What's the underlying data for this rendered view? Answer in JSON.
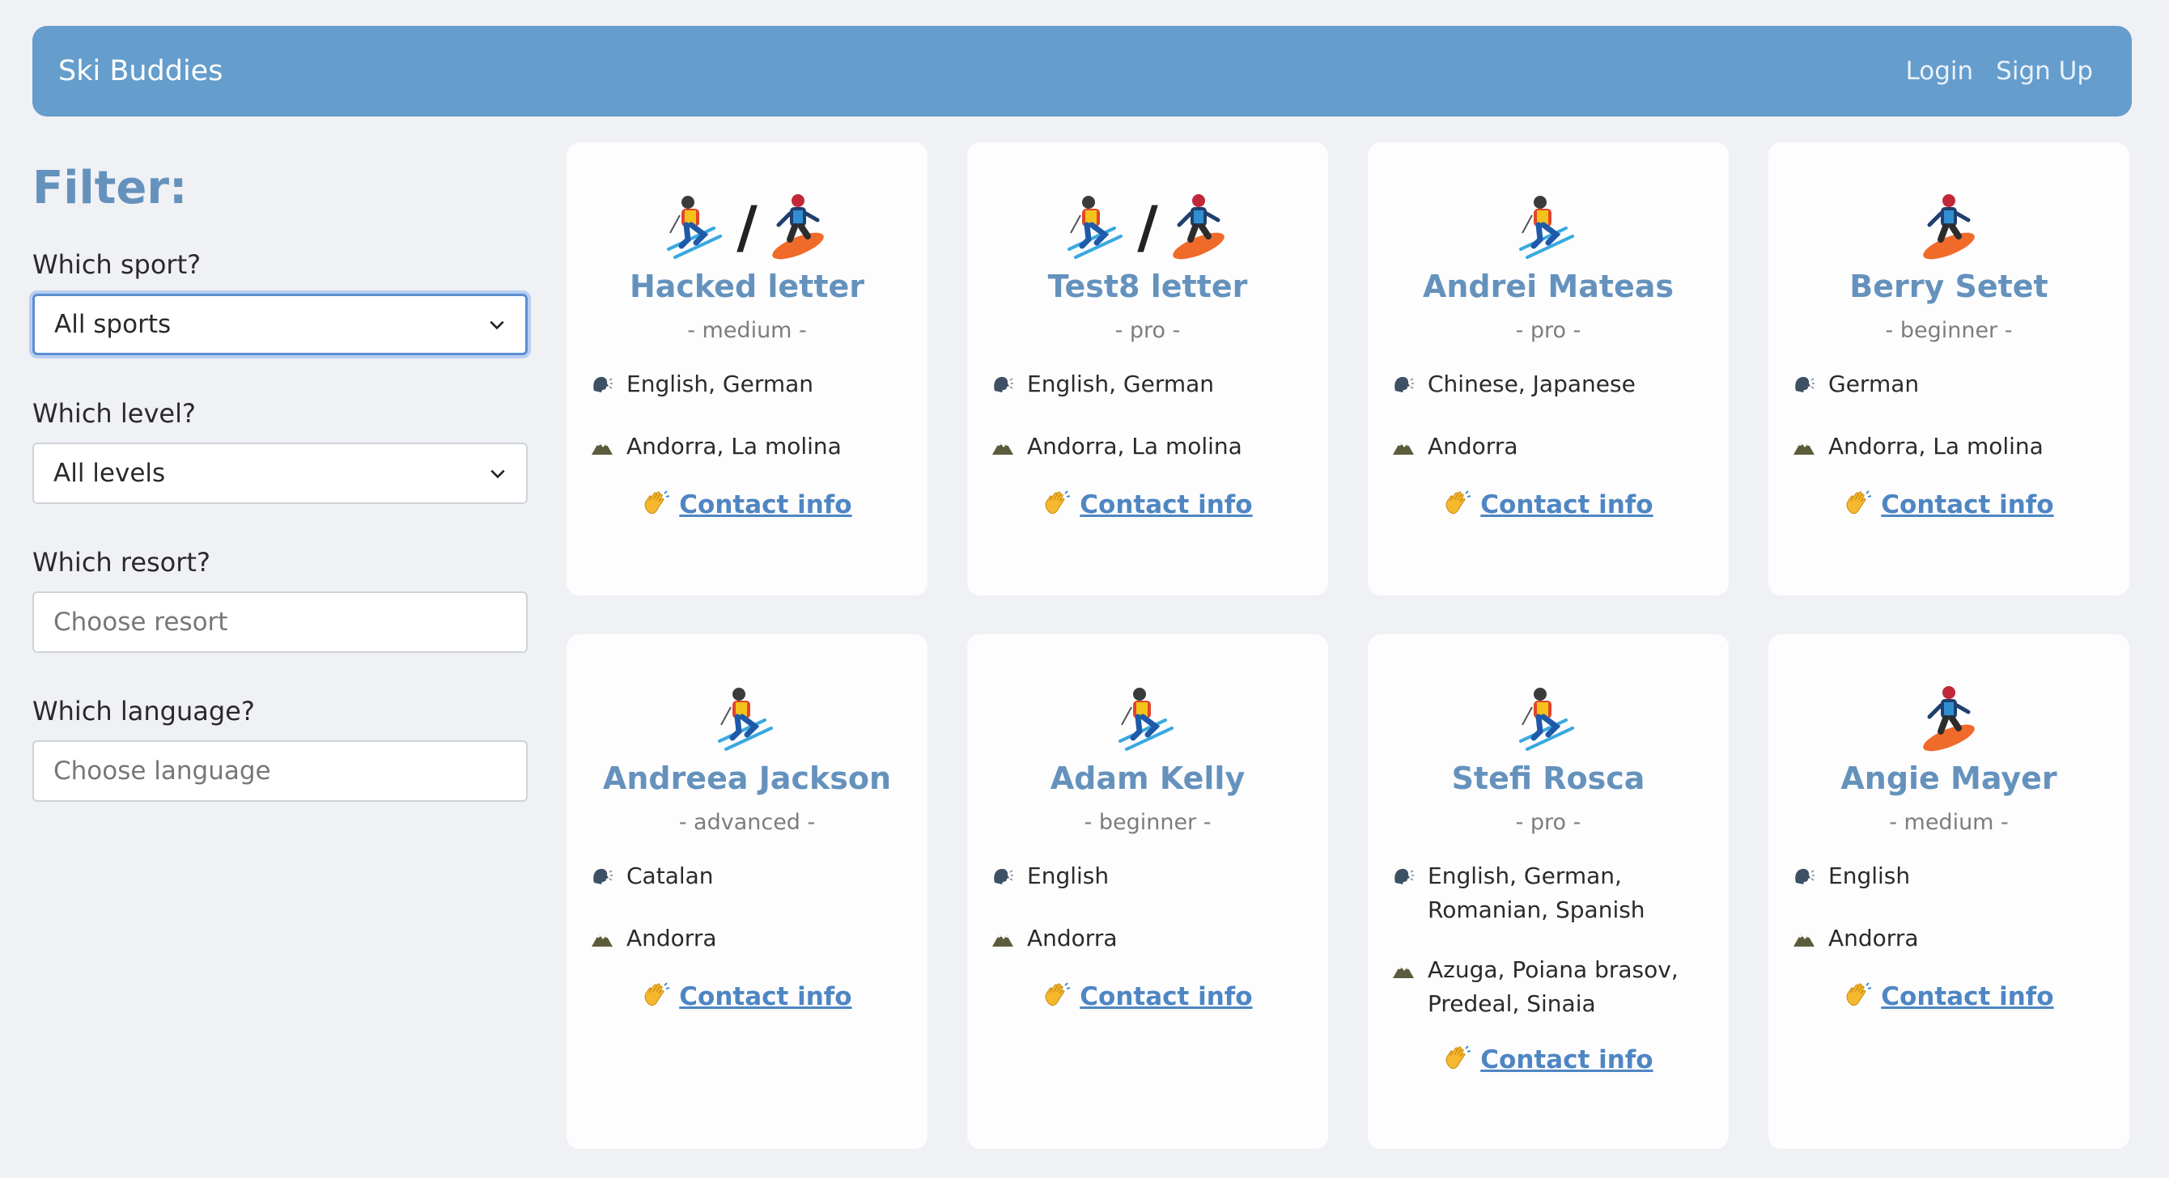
{
  "nav": {
    "brand": "Ski Buddies",
    "login": "Login",
    "signup": "Sign Up"
  },
  "filter": {
    "title": "Filter:",
    "sport_label": "Which sport?",
    "sport_value": "All sports",
    "level_label": "Which level?",
    "level_value": "All levels",
    "resort_label": "Which resort?",
    "resort_placeholder": "Choose resort",
    "language_label": "Which language?",
    "language_placeholder": "Choose language"
  },
  "contact_label": "Contact info",
  "icons": {
    "ski": "skier-icon",
    "snowboard": "snowboarder-icon",
    "language": "speaking-head-icon",
    "resort": "mountain-icon",
    "contact": "waving-hand-icon"
  },
  "colors": {
    "navbar": "#659dcc",
    "accent": "#6592bd",
    "link": "#4e86c3",
    "background": "#eff1f5"
  },
  "cards": [
    {
      "name": "Hacked letter",
      "level": "- medium -",
      "sports": [
        "ski",
        "snowboard"
      ],
      "languages": "English, German",
      "resorts": "Andorra, La molina"
    },
    {
      "name": "Test8 letter",
      "level": "- pro -",
      "sports": [
        "ski",
        "snowboard"
      ],
      "languages": "English, German",
      "resorts": "Andorra, La molina"
    },
    {
      "name": "Andrei Mateas",
      "level": "- pro -",
      "sports": [
        "ski"
      ],
      "languages": "Chinese, Japanese",
      "resorts": "Andorra"
    },
    {
      "name": "Berry Setet",
      "level": "- beginner -",
      "sports": [
        "snowboard"
      ],
      "languages": "German",
      "resorts": "Andorra, La molina"
    },
    {
      "name": "Andreea Jackson",
      "level": "- advanced -",
      "sports": [
        "ski"
      ],
      "languages": "Catalan",
      "resorts": "Andorra"
    },
    {
      "name": "Adam Kelly",
      "level": "- beginner -",
      "sports": [
        "ski"
      ],
      "languages": "English",
      "resorts": "Andorra"
    },
    {
      "name": "Stefi Rosca",
      "level": "- pro -",
      "sports": [
        "ski"
      ],
      "languages": "English, German, Romanian, Spanish",
      "resorts": "Azuga, Poiana brasov, Predeal, Sinaia"
    },
    {
      "name": "Angie Mayer",
      "level": "- medium -",
      "sports": [
        "snowboard"
      ],
      "languages": "English",
      "resorts": "Andorra"
    }
  ]
}
